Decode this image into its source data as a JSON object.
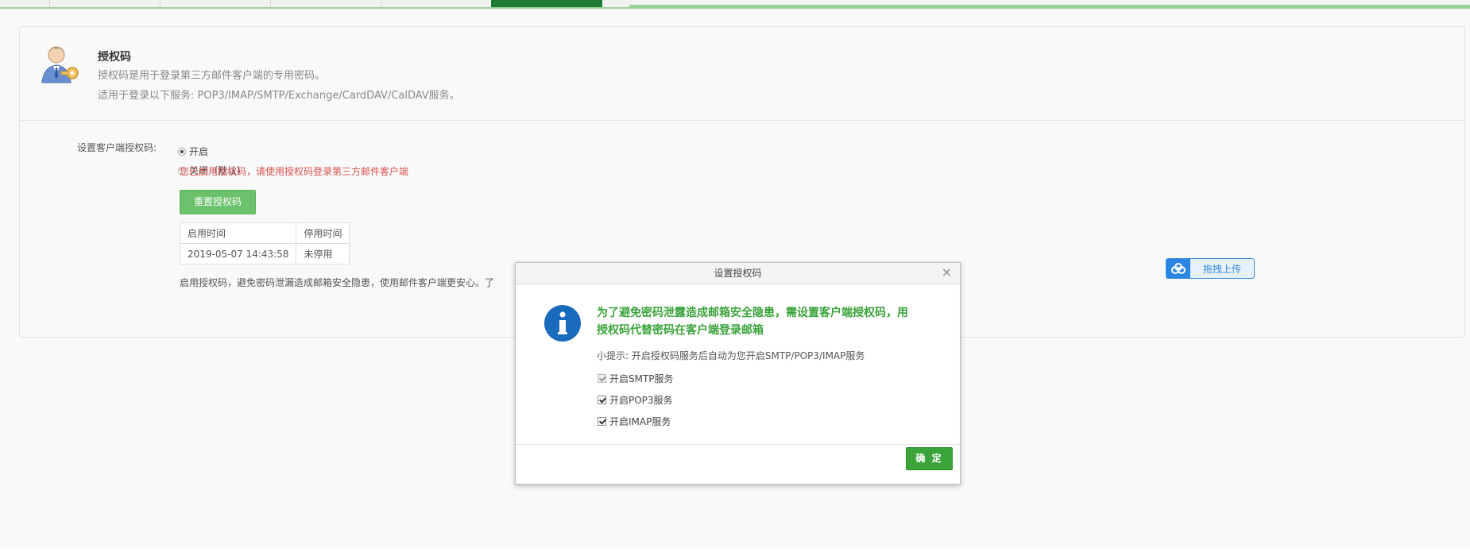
{
  "header": {
    "title": "授权码",
    "desc": "授权码是用于登录第三方邮件客户端的专用密码。",
    "services": "适用于登录以下服务: POP3/IMAP/SMTP/Exchange/CardDAV/CalDAV服务。"
  },
  "form": {
    "label": "设置客户端授权码:",
    "option_on": "开启",
    "option_off": "关闭（默认）",
    "selected": "开启",
    "notice": "您已启用授权码，请使用授权码登录第三方邮件客户端",
    "reset_button": "重置授权码",
    "table": {
      "headers": [
        "启用时间",
        "停用时间"
      ],
      "rows": [
        [
          "2019-05-07 14:43:58",
          "未停用"
        ]
      ]
    },
    "bottom_text": "启用授权码，避免密码泄漏造成邮箱安全隐患，使用邮件客户端更安心。了"
  },
  "upload": {
    "label": "拖拽上传"
  },
  "modal": {
    "title": "设置授权码",
    "close": "×",
    "main_line1": "为了避免密码泄露造成邮箱安全隐患，需设置客户端授权码，用",
    "main_line2": "授权码代替密码在客户端登录邮箱",
    "tip": "小提示: 开启授权码服务后自动为您开启SMTP/POP3/IMAP服务",
    "options": [
      {
        "label": "开启SMTP服务",
        "checked": true,
        "disabled": true
      },
      {
        "label": "开启POP3服务",
        "checked": true,
        "disabled": false
      },
      {
        "label": "开启IMAP服务",
        "checked": true,
        "disabled": false
      }
    ],
    "ok_button": "确 定"
  },
  "colors": {
    "accent_green": "#3aa33a",
    "button_green_light": "#6cc26c",
    "notice_red": "#d9534f",
    "info_blue": "#1a6bbd"
  }
}
